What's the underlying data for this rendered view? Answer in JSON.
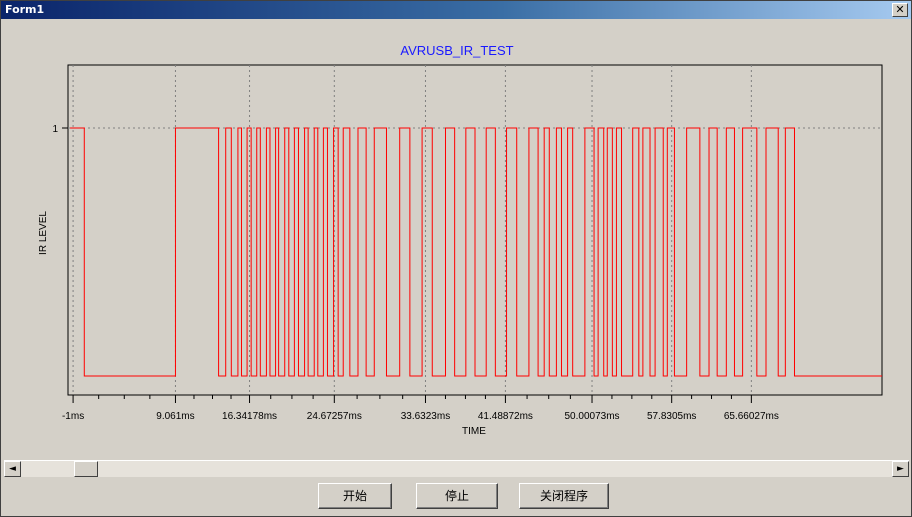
{
  "window": {
    "title": "Form1",
    "close_glyph": "✕"
  },
  "chart": {
    "title": "AVRUSB_IR_TEST",
    "xlabel": "TIME",
    "ylabel": "IR LEVEL",
    "y_tick_label": "1",
    "colors": {
      "signal": "#ff0000",
      "title": "#1a1aff",
      "plot_bg": "#d4d0c8",
      "grid": "#808080"
    }
  },
  "chart_data": {
    "type": "line",
    "title": "AVRUSB_IR_TEST",
    "xlabel": "TIME",
    "ylabel": "IR LEVEL",
    "x_unit": "ms",
    "xlim": [
      -1.5,
      78.5
    ],
    "ylim": [
      0,
      1.25
    ],
    "x_tick_labels": [
      "-1ms",
      "9.061ms",
      "16.34178ms",
      "24.67257ms",
      "33.6323ms",
      "41.48872ms",
      "50.00073ms",
      "57.8305ms",
      "65.66027ms"
    ],
    "x_ticks": [
      -1,
      9.061,
      16.34178,
      24.67257,
      33.6323,
      41.48872,
      50.00073,
      57.8305,
      65.66027
    ],
    "y_ticks": [
      1
    ],
    "grid": true,
    "series": [
      {
        "step": true,
        "start": [
          -1.3,
          1
        ],
        "transitions": [
          0.1,
          9.061,
          13.3,
          14.0,
          14.55,
          15.2,
          15.55,
          16.1,
          16.5,
          17.05,
          17.4,
          18.0,
          18.35,
          18.9,
          19.2,
          19.8,
          20.2,
          20.75,
          21.15,
          21.75,
          22.1,
          22.7,
          23.05,
          23.6,
          24.0,
          24.6,
          25.05,
          25.55,
          26.2,
          27.0,
          27.8,
          28.6,
          29.8,
          31.1,
          32.1,
          33.3,
          34.3,
          35.6,
          36.5,
          37.6,
          38.5,
          39.6,
          40.5,
          41.6,
          42.6,
          43.8,
          44.7,
          45.3,
          45.8,
          46.5,
          47.0,
          47.6,
          48.1,
          49.3,
          50.2,
          50.6,
          51.15,
          51.5,
          52.0,
          52.4,
          52.9,
          54.0,
          54.6,
          55.0,
          55.7,
          56.2,
          57.0,
          57.4,
          58.1,
          59.3,
          60.6,
          61.5,
          62.3,
          63.2,
          64.0,
          64.8,
          66.2,
          67.1,
          68.3,
          69.0,
          69.9
        ]
      }
    ]
  },
  "scrollbar": {
    "left_glyph": "◄",
    "right_glyph": "►"
  },
  "buttons": {
    "start": "开始",
    "stop": "停止",
    "exit": "关闭程序"
  }
}
